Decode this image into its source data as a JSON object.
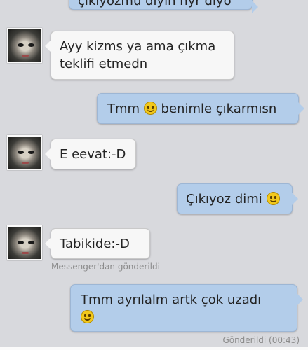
{
  "messages": [
    {
      "text": "çıkıyozmu diyin hyr diyo"
    },
    {
      "line1": "Ayy kizms ya ama çıkma",
      "line2": "teklifi etmedn"
    },
    {
      "before": "Tmm",
      "after": "benimle çıkarmısn",
      "icon": "smiley-icon"
    },
    {
      "text": "E eevat:-D"
    },
    {
      "text": "Çıkıyoz dimi",
      "icon": "smiley-icon"
    },
    {
      "text": "Tabikide:-D",
      "status": "Messenger'dan gönderildi"
    },
    {
      "text": "Tmm ayrılalm artk çok uzadı",
      "icon": "smiley-icon",
      "status": "Gönderildi (00:43)"
    }
  ],
  "colors": {
    "incoming": "#f7f7f7",
    "outgoing": "#b3cdea",
    "background": "#d8d9dd"
  }
}
